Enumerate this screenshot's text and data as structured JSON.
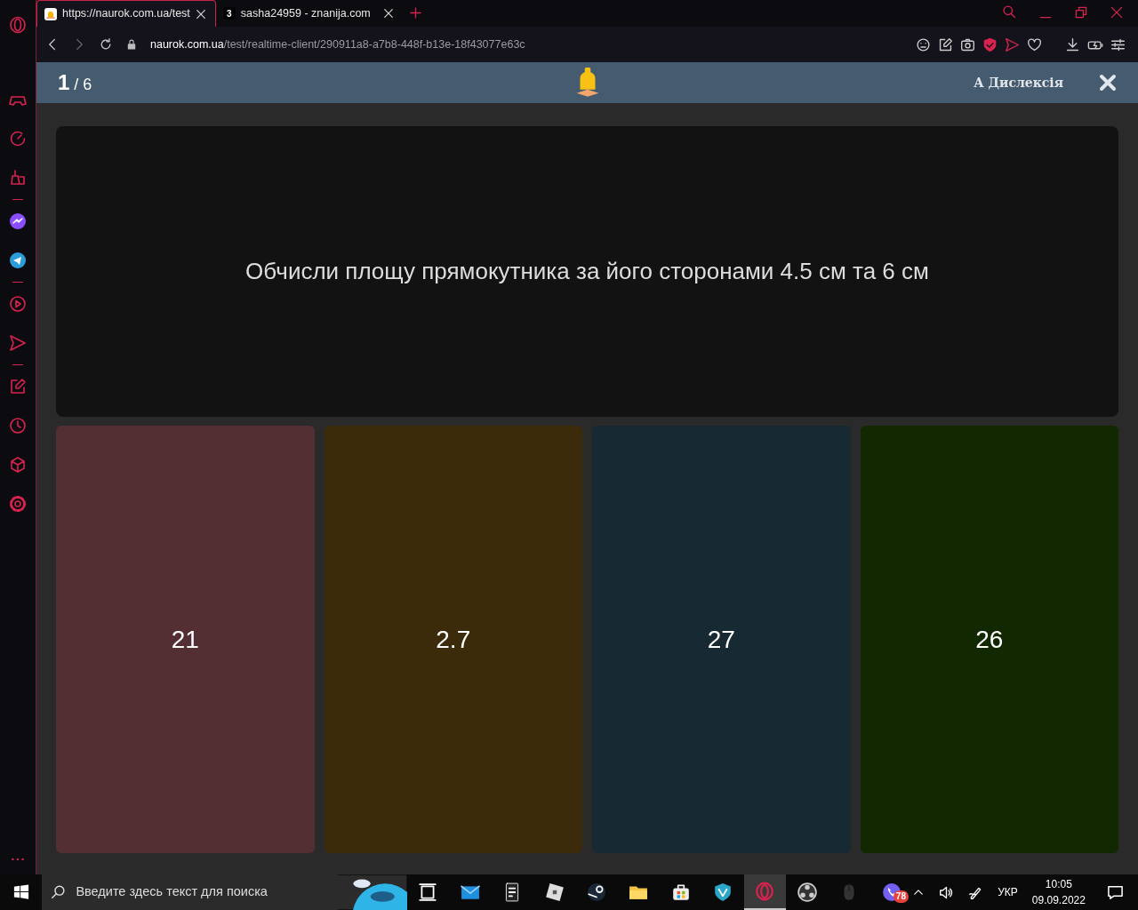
{
  "browser_tabs": [
    {
      "title": "https://naurok.com.ua/test",
      "selected": true
    },
    {
      "title": "sasha24959 - znanija.com",
      "favicon_text": "3",
      "selected": false
    }
  ],
  "address_bar": {
    "host": "naurok.com.ua",
    "path": "/test/realtime-client/290911a8-a7b8-448f-b13e-18f43077e63c"
  },
  "quiz_header": {
    "current": "1",
    "total": "/ 6",
    "dyslexia_label": "А Дислексія"
  },
  "question": {
    "text": "Обчисли площу прямокутника за його сторонами 4.5 см та 6 см"
  },
  "answers": [
    {
      "text": "21",
      "color": "#532e33"
    },
    {
      "text": "2.7",
      "color": "#3c2b0a"
    },
    {
      "text": "27",
      "color": "#172a33"
    },
    {
      "text": "26",
      "color": "#122800"
    }
  ],
  "taskbar": {
    "search_placeholder": "Введите здесь текст для поиска",
    "viber_badge": "78",
    "language": "УКР",
    "time": "10:05",
    "date": "09.09.2022"
  }
}
